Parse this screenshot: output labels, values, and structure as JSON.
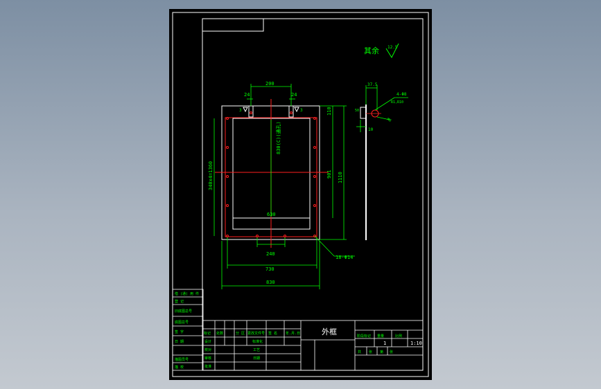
{
  "drawing": {
    "title": "外框",
    "roughness_note": "其余",
    "roughness_value": "12.5",
    "callout_holes": "4-Φ8",
    "callout_edge_holes": "18-Φ14",
    "dim_top_span": "200",
    "dim_tab_left": "24",
    "dim_tab_right": "24",
    "dim_inner_width": "630",
    "dim_bottom_spacing": "240",
    "dim_bottom_inner": "730",
    "dim_bottom_outer": "830",
    "dim_right_top": "110",
    "dim_right_inner": "901",
    "dim_right_outer": "1110",
    "dim_left_vertical": "340x4=1360",
    "dim_center_vertical": "830(C)(通孔)",
    "dim_side_width": "37.5",
    "dim_side_small": "10",
    "dim_side_c": "50",
    "dim_side_bolt": "M8",
    "dim_side_radius": "R1,R10",
    "weld_label_left": "3",
    "weld_label_right": "3"
  },
  "title_block": {
    "left_strip": [
      "借 (通) 用 件",
      "登 记",
      "旧底图总号",
      "底图总号",
      "签 字",
      "日 期",
      "描图员号",
      "描 校"
    ],
    "rev_headers": [
      "标记",
      "处数",
      "分 区",
      "更改文件号",
      "签 名",
      "年.月.日"
    ],
    "sign_rows": [
      "设计",
      "校对",
      "审核",
      "批准"
    ],
    "sign_mid": [
      "标准化",
      "工艺",
      "日期"
    ],
    "right_headers": [
      "阶段标记",
      "重量",
      "比例"
    ],
    "count": "1",
    "scale": "1:10",
    "sheet_labels": [
      "共",
      "张",
      "第",
      "张"
    ]
  }
}
